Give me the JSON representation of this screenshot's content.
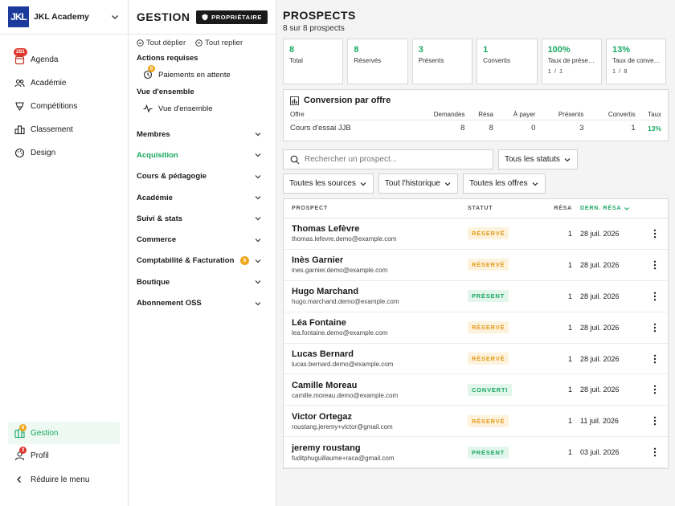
{
  "brand": {
    "logo_text": "JKL",
    "name": "JKL Academy"
  },
  "nav": {
    "items": [
      {
        "label": "Agenda",
        "icon": "calendar-icon",
        "badge": "281"
      },
      {
        "label": "Académie",
        "icon": "users-icon",
        "badge": ""
      },
      {
        "label": "Compétitions",
        "icon": "trophy-icon",
        "badge": ""
      },
      {
        "label": "Classement",
        "icon": "ranking-icon",
        "badge": ""
      },
      {
        "label": "Design",
        "icon": "palette-icon",
        "badge": ""
      }
    ],
    "bottom": [
      {
        "label": "Gestion",
        "icon": "management-icon",
        "badge": "6",
        "active": true
      },
      {
        "label": "Profil",
        "icon": "user-icon",
        "badge": "3",
        "active": false
      }
    ],
    "collapse_label": "Réduire le menu"
  },
  "gestion": {
    "title": "GESTION",
    "owner_label": "PROPRIÉTAIRE",
    "expand_all": "Tout déplier",
    "collapse_all": "Tout replier",
    "actions_heading": "Actions requises",
    "pending_payments": "Paiements en attente",
    "pending_badge": "6",
    "overview_heading": "Vue d'ensemble",
    "overview_item": "Vue d'ensemble",
    "sections": [
      {
        "label": "Membres",
        "active": false,
        "badge": ""
      },
      {
        "label": "Acquisition",
        "active": true,
        "badge": ""
      },
      {
        "label": "Cours & pédagogie",
        "active": false,
        "badge": ""
      },
      {
        "label": "Académie",
        "active": false,
        "badge": ""
      },
      {
        "label": "Suivi & stats",
        "active": false,
        "badge": ""
      },
      {
        "label": "Commerce",
        "active": false,
        "badge": ""
      },
      {
        "label": "Comptabilité & Facturation",
        "active": false,
        "badge": "6"
      },
      {
        "label": "Boutique",
        "active": false,
        "badge": ""
      },
      {
        "label": "Abonnement OSS",
        "active": false,
        "badge": ""
      }
    ]
  },
  "main": {
    "title": "PROSPECTS",
    "subtitle": "8 sur 8 prospects",
    "stats": [
      {
        "value": "8",
        "label": "Total",
        "sub": ""
      },
      {
        "value": "8",
        "label": "Réservés",
        "sub": ""
      },
      {
        "value": "3",
        "label": "Présents",
        "sub": ""
      },
      {
        "value": "1",
        "label": "Convertis",
        "sub": ""
      },
      {
        "value": "100%",
        "label": "Taux de présence",
        "sub": "1 / 1"
      },
      {
        "value": "13%",
        "label": "Taux de conversion",
        "sub": "1 / 8"
      }
    ],
    "conversion": {
      "title": "Conversion par offre",
      "headers": [
        "Offre",
        "Demandes",
        "Résa",
        "À payer",
        "Présents",
        "Convertis",
        "Taux"
      ],
      "rows": [
        [
          "Cours d'essai JJB",
          "8",
          "8",
          "0",
          "3",
          "1",
          "13%"
        ]
      ]
    },
    "search_placeholder": "Rechercher un prospect...",
    "filters": [
      "Tous les statuts",
      "Toutes les sources",
      "Tout l'historique",
      "Toutes les offres"
    ],
    "table": {
      "headers": {
        "prospect": "PROSPECT",
        "status": "STATUT",
        "resa": "RÉSA",
        "last": "DERN. RÉSA"
      },
      "rows": [
        {
          "name": "Thomas Lefèvre",
          "email": "thomas.lefevre.demo@example.com",
          "status": "RÉSERVÉ",
          "kind": "reserve",
          "resa": "1",
          "date": "28 juil. 2026"
        },
        {
          "name": "Inès Garnier",
          "email": "ines.garnier.demo@example.com",
          "status": "RÉSERVÉ",
          "kind": "reserve",
          "resa": "1",
          "date": "28 juil. 2026"
        },
        {
          "name": "Hugo Marchand",
          "email": "hugo.marchand.demo@example.com",
          "status": "PRÉSENT",
          "kind": "present",
          "resa": "1",
          "date": "28 juil. 2026"
        },
        {
          "name": "Léa Fontaine",
          "email": "lea.fontaine.demo@example.com",
          "status": "RÉSERVÉ",
          "kind": "reserve",
          "resa": "1",
          "date": "28 juil. 2026"
        },
        {
          "name": "Lucas Bernard",
          "email": "lucas.bernard.demo@example.com",
          "status": "RÉSERVÉ",
          "kind": "reserve",
          "resa": "1",
          "date": "28 juil. 2026"
        },
        {
          "name": "Camille Moreau",
          "email": "camille.moreau.demo@example.com",
          "status": "CONVERTI",
          "kind": "converti",
          "resa": "1",
          "date": "28 juil. 2026"
        },
        {
          "name": "Victor Ortegaz",
          "email": "roustang.jeremy+victor@gmail.com",
          "status": "RÉSERVÉ",
          "kind": "reserve",
          "resa": "1",
          "date": "11 juil. 2026"
        },
        {
          "name": "jeremy roustang",
          "email": "fuditphuguillaume+raca@gmail.com",
          "status": "PRÉSENT",
          "kind": "present",
          "resa": "1",
          "date": "03 juil. 2026"
        }
      ]
    }
  },
  "colors": {
    "accent": "#1aa862",
    "brand": "#1c3a9c",
    "warning": "#e39b18",
    "badge_red": "#e0362c"
  }
}
